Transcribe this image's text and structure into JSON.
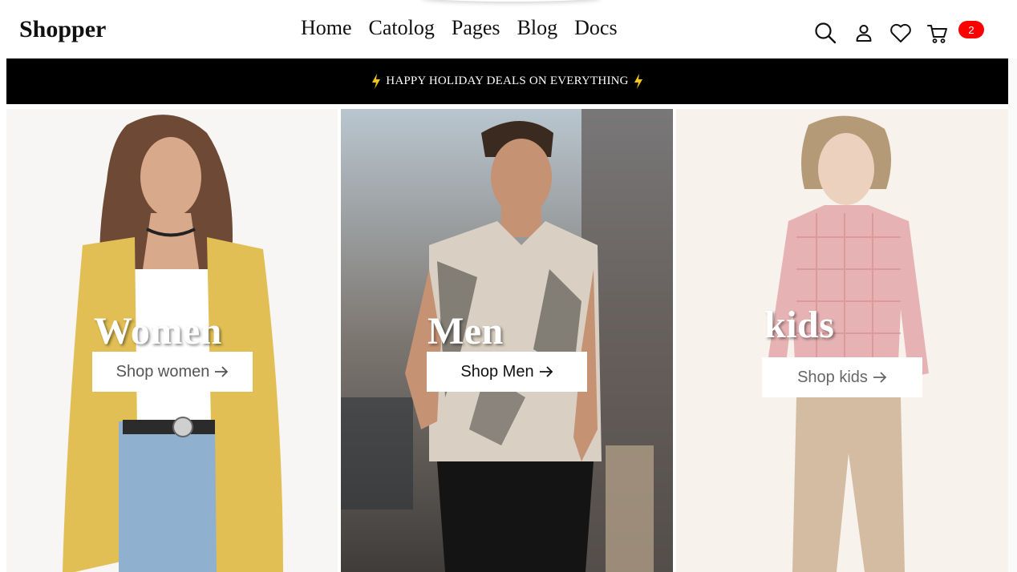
{
  "brand": {
    "logo": "Shopper"
  },
  "nav": [
    {
      "label": "Home"
    },
    {
      "label": "Catolog"
    },
    {
      "label": "Pages"
    },
    {
      "label": "Blog"
    },
    {
      "label": "Docs"
    }
  ],
  "header_icons": [
    "search-icon",
    "user-icon",
    "heart-icon",
    "cart-icon"
  ],
  "cart": {
    "count": "2"
  },
  "promo": {
    "text": "HAPPY HOLIDAY DEALS ON EVERYTHING",
    "icon": "lightning-bolt-icon",
    "icon_color": "#f5c518"
  },
  "categories": [
    {
      "title": "Women",
      "button": "Shop women",
      "button_color": "#555555"
    },
    {
      "title": "Men",
      "button": "Shop Men",
      "button_color": "#111111"
    },
    {
      "title": "kids",
      "button": "Shop kids",
      "button_color": "#666666"
    }
  ],
  "colors": {
    "accent_badge": "#ff0000",
    "promo_bg": "#000000"
  }
}
